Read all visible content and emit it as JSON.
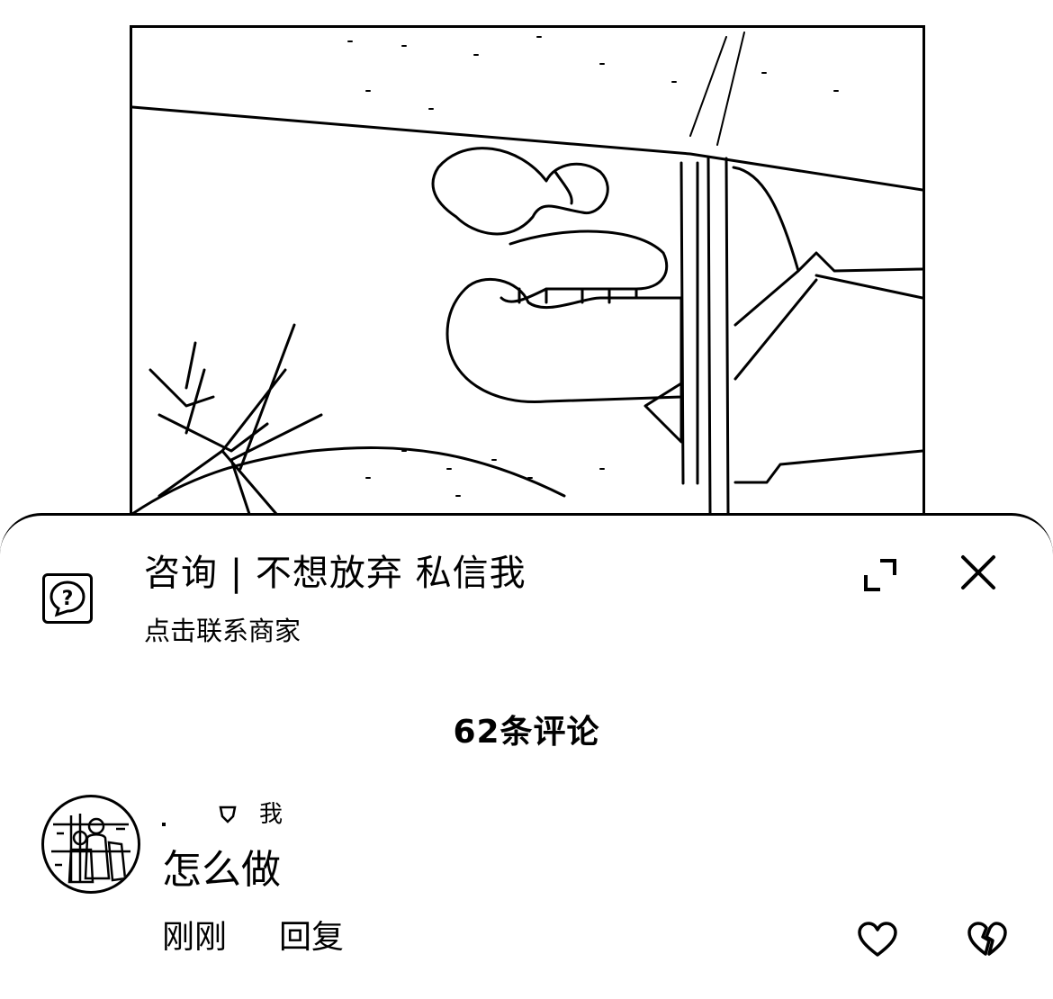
{
  "video": {
    "icon": "video-preview-image"
  },
  "ad": {
    "icon": "question-bubble-icon",
    "title": "咨询 | 不想放弃 私信我",
    "subtitle": "点击联系商家"
  },
  "sheet_controls": {
    "expand_icon": "expand-icon",
    "close_icon": "close-icon"
  },
  "comments": {
    "header": "62条评论",
    "items": [
      {
        "avatar_icon": "avatar-image",
        "badge_icon": "badge-icon",
        "me_label": "我",
        "text": "怎么做",
        "time": "刚刚",
        "reply_label": "回复",
        "like_icon": "heart-icon",
        "dislike_icon": "broken-heart-icon"
      }
    ]
  }
}
